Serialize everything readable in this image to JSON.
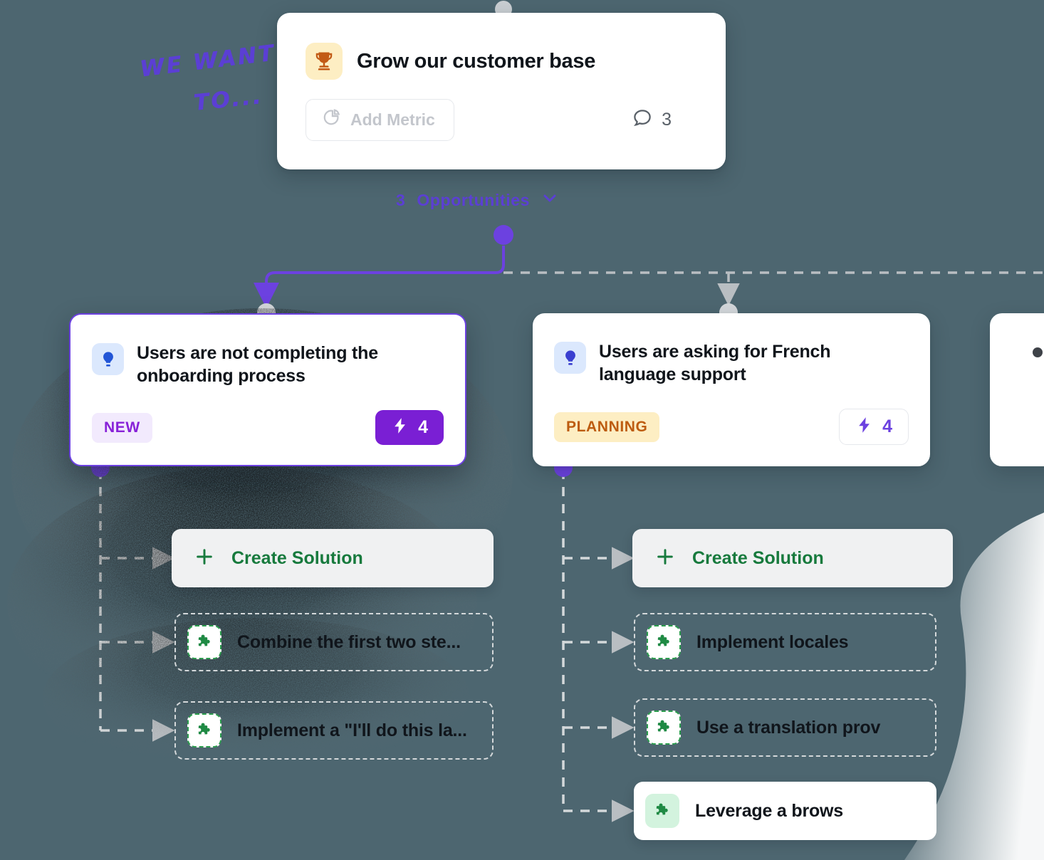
{
  "canvas": {
    "background_color": "#4d6670",
    "annotation": {
      "line1": "WE WANT",
      "line2": "TO...",
      "color": "#5b3fd4"
    }
  },
  "goal": {
    "icon": "trophy-icon",
    "title": "Grow our customer base",
    "add_metric": {
      "icon": "pie-chart-icon",
      "label": "Add Metric"
    },
    "comments": {
      "icon": "comment-bubble-icon",
      "count": "3"
    }
  },
  "opportunities_header": {
    "count": "3",
    "label": "Opportunities",
    "chevron": "chevron-down-icon"
  },
  "opportunities": [
    {
      "icon": "lightbulb-icon",
      "title": "Users are not completing the onboarding process",
      "status": "NEW",
      "status_bg": "#f2eafd",
      "status_color": "#8822d8",
      "impact": {
        "icon": "lightning-bolt-icon",
        "value": "4",
        "style": "filled",
        "bg": "#7a1fd4"
      },
      "selected": true,
      "solutions": [
        {
          "type": "create",
          "icon": "plus-icon",
          "label": "Create Solution",
          "color": "#177a3d"
        },
        {
          "type": "dashed",
          "icon": "puzzle-piece-icon",
          "label": "Combine the first two ste..."
        },
        {
          "type": "dashed",
          "icon": "puzzle-piece-icon",
          "label": "Implement a \"I'll do this la..."
        }
      ]
    },
    {
      "icon": "lightbulb-icon",
      "title": "Users are asking for French language support",
      "status": "PLANNING",
      "status_bg": "#fdeec3",
      "status_color": "#bd5c10",
      "impact": {
        "icon": "lightning-bolt-icon",
        "value": "4",
        "style": "outline",
        "bg": "#ffffff"
      },
      "selected": false,
      "solutions": [
        {
          "type": "create",
          "icon": "plus-icon",
          "label": "Create Solution",
          "color": "#177a3d"
        },
        {
          "type": "dashed",
          "icon": "puzzle-piece-icon",
          "label": "Implement locales"
        },
        {
          "type": "dashed",
          "icon": "puzzle-piece-icon",
          "label": "Use a translation prov"
        },
        {
          "type": "solid",
          "icon": "puzzle-piece-icon",
          "label": "Leverage a brows"
        }
      ]
    }
  ]
}
